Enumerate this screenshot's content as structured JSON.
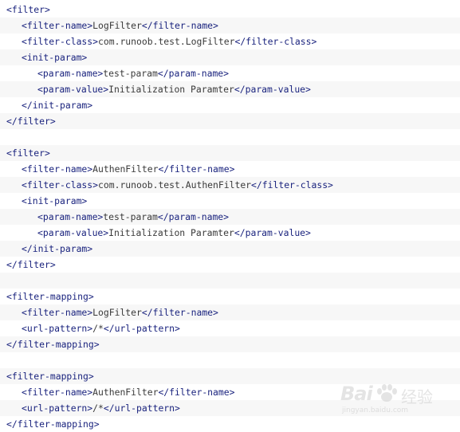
{
  "code": {
    "lines": [
      {
        "indent": 0,
        "open": "<filter>",
        "text": "",
        "close": ""
      },
      {
        "indent": 1,
        "open": "<filter-name>",
        "text": "LogFilter",
        "close": "</filter-name>"
      },
      {
        "indent": 1,
        "open": "<filter-class>",
        "text": "com.runoob.test.LogFilter",
        "close": "</filter-class>"
      },
      {
        "indent": 1,
        "open": "<init-param>",
        "text": "",
        "close": ""
      },
      {
        "indent": 2,
        "open": "<param-name>",
        "text": "test-param",
        "close": "</param-name>"
      },
      {
        "indent": 2,
        "open": "<param-value>",
        "text": "Initialization Paramter",
        "close": "</param-value>"
      },
      {
        "indent": 1,
        "open": "</init-param>",
        "text": "",
        "close": ""
      },
      {
        "indent": 0,
        "open": "</filter>",
        "text": "",
        "close": ""
      },
      {
        "indent": 0,
        "open": "",
        "text": "",
        "close": ""
      },
      {
        "indent": 0,
        "open": "<filter>",
        "text": "",
        "close": ""
      },
      {
        "indent": 1,
        "open": "<filter-name>",
        "text": "AuthenFilter",
        "close": "</filter-name>"
      },
      {
        "indent": 1,
        "open": "<filter-class>",
        "text": "com.runoob.test.AuthenFilter",
        "close": "</filter-class>"
      },
      {
        "indent": 1,
        "open": "<init-param>",
        "text": "",
        "close": ""
      },
      {
        "indent": 2,
        "open": "<param-name>",
        "text": "test-param",
        "close": "</param-name>"
      },
      {
        "indent": 2,
        "open": "<param-value>",
        "text": "Initialization Paramter",
        "close": "</param-value>"
      },
      {
        "indent": 1,
        "open": "</init-param>",
        "text": "",
        "close": ""
      },
      {
        "indent": 0,
        "open": "</filter>",
        "text": "",
        "close": ""
      },
      {
        "indent": 0,
        "open": "",
        "text": "",
        "close": ""
      },
      {
        "indent": 0,
        "open": "<filter-mapping>",
        "text": "",
        "close": ""
      },
      {
        "indent": 1,
        "open": "<filter-name>",
        "text": "LogFilter",
        "close": "</filter-name>"
      },
      {
        "indent": 1,
        "open": "<url-pattern>",
        "text": "/*",
        "close": "</url-pattern>"
      },
      {
        "indent": 0,
        "open": "</filter-mapping>",
        "text": "",
        "close": ""
      },
      {
        "indent": 0,
        "open": "",
        "text": "",
        "close": ""
      },
      {
        "indent": 0,
        "open": "<filter-mapping>",
        "text": "",
        "close": ""
      },
      {
        "indent": 1,
        "open": "<filter-name>",
        "text": "AuthenFilter",
        "close": "</filter-name>"
      },
      {
        "indent": 1,
        "open": "<url-pattern>",
        "text": "/*",
        "close": "</url-pattern>"
      },
      {
        "indent": 0,
        "open": "</filter-mapping>",
        "text": "",
        "close": ""
      }
    ]
  },
  "watermark": {
    "brand": "Bai",
    "brand_cn": "经验",
    "url": "jingyan.baidu.com",
    "logo_icon": "paw-icon"
  },
  "colors": {
    "tag": "#1a237e",
    "text": "#3a3a3a",
    "stripe": "#f7f7f7"
  }
}
